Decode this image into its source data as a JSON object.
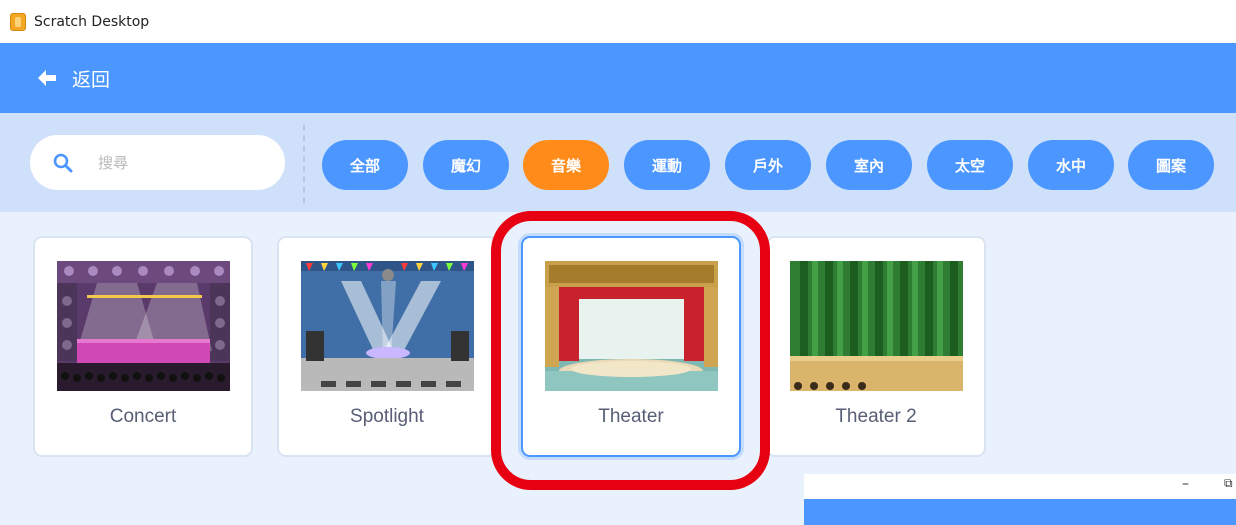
{
  "window": {
    "title": "Scratch Desktop",
    "icon": "scratch-app-icon"
  },
  "header": {
    "back_label": "返回",
    "back_icon": "arrow-left-icon"
  },
  "search": {
    "placeholder": "搜尋",
    "icon": "search-icon"
  },
  "tags": [
    {
      "label": "全部",
      "active": false
    },
    {
      "label": "魔幻",
      "active": false
    },
    {
      "label": "音樂",
      "active": true
    },
    {
      "label": "運動",
      "active": false
    },
    {
      "label": "戶外",
      "active": false
    },
    {
      "label": "室內",
      "active": false
    },
    {
      "label": "太空",
      "active": false
    },
    {
      "label": "水中",
      "active": false
    },
    {
      "label": "圖案",
      "active": false
    }
  ],
  "backdrops": [
    {
      "name": "Concert",
      "selected": false
    },
    {
      "name": "Spotlight",
      "selected": false
    },
    {
      "name": "Theater",
      "selected": true
    },
    {
      "name": "Theater 2",
      "selected": false
    }
  ],
  "mini_window": {
    "minimize": "–",
    "restore": "⧉"
  },
  "colors": {
    "primary": "#4c97ff",
    "active_tag": "#ff8c1a",
    "highlight": "#e60012"
  }
}
